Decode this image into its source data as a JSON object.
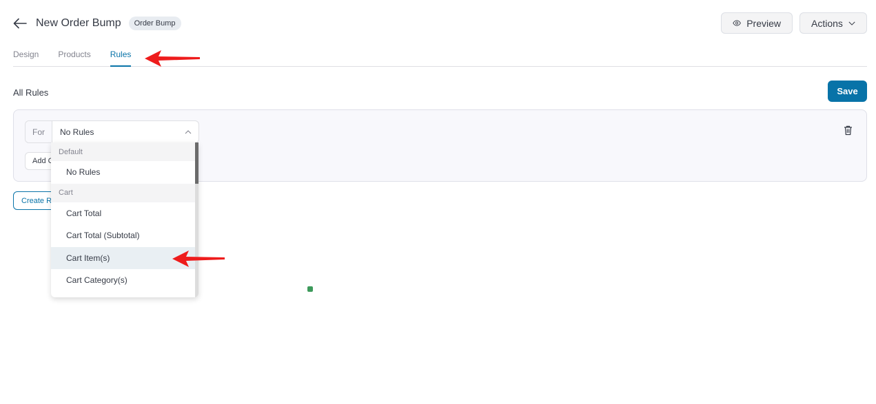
{
  "header": {
    "back_icon": "arrow-left-icon",
    "title": "New Order Bump",
    "badge": "Order Bump"
  },
  "top_actions": {
    "preview_label": "Preview",
    "preview_icon": "eye-icon",
    "actions_label": "Actions",
    "actions_icon": "chevron-down-icon"
  },
  "tabs": [
    {
      "label": "Design",
      "active": false
    },
    {
      "label": "Products",
      "active": false
    },
    {
      "label": "Rules",
      "active": true
    }
  ],
  "section": {
    "title": "All Rules",
    "save_label": "Save"
  },
  "rule": {
    "for_label": "For",
    "selected_value": "No Rules",
    "add_condition_label": "Add Condition",
    "delete_icon": "trash-icon"
  },
  "create_rule_label": "Create Rule Group",
  "dropdown": {
    "groups": [
      {
        "label": "Default",
        "items": [
          "No Rules"
        ]
      },
      {
        "label": "Cart",
        "items": [
          "Cart Total",
          "Cart Total (Subtotal)",
          "Cart Item(s)",
          "Cart Category(s)"
        ]
      }
    ],
    "hovered_item": "Cart Item(s)"
  },
  "annotations": {
    "arrow_color": "#ee1c1c"
  },
  "colors": {
    "accent": "#0873a8",
    "text": "#353a45",
    "muted": "#82838e"
  }
}
